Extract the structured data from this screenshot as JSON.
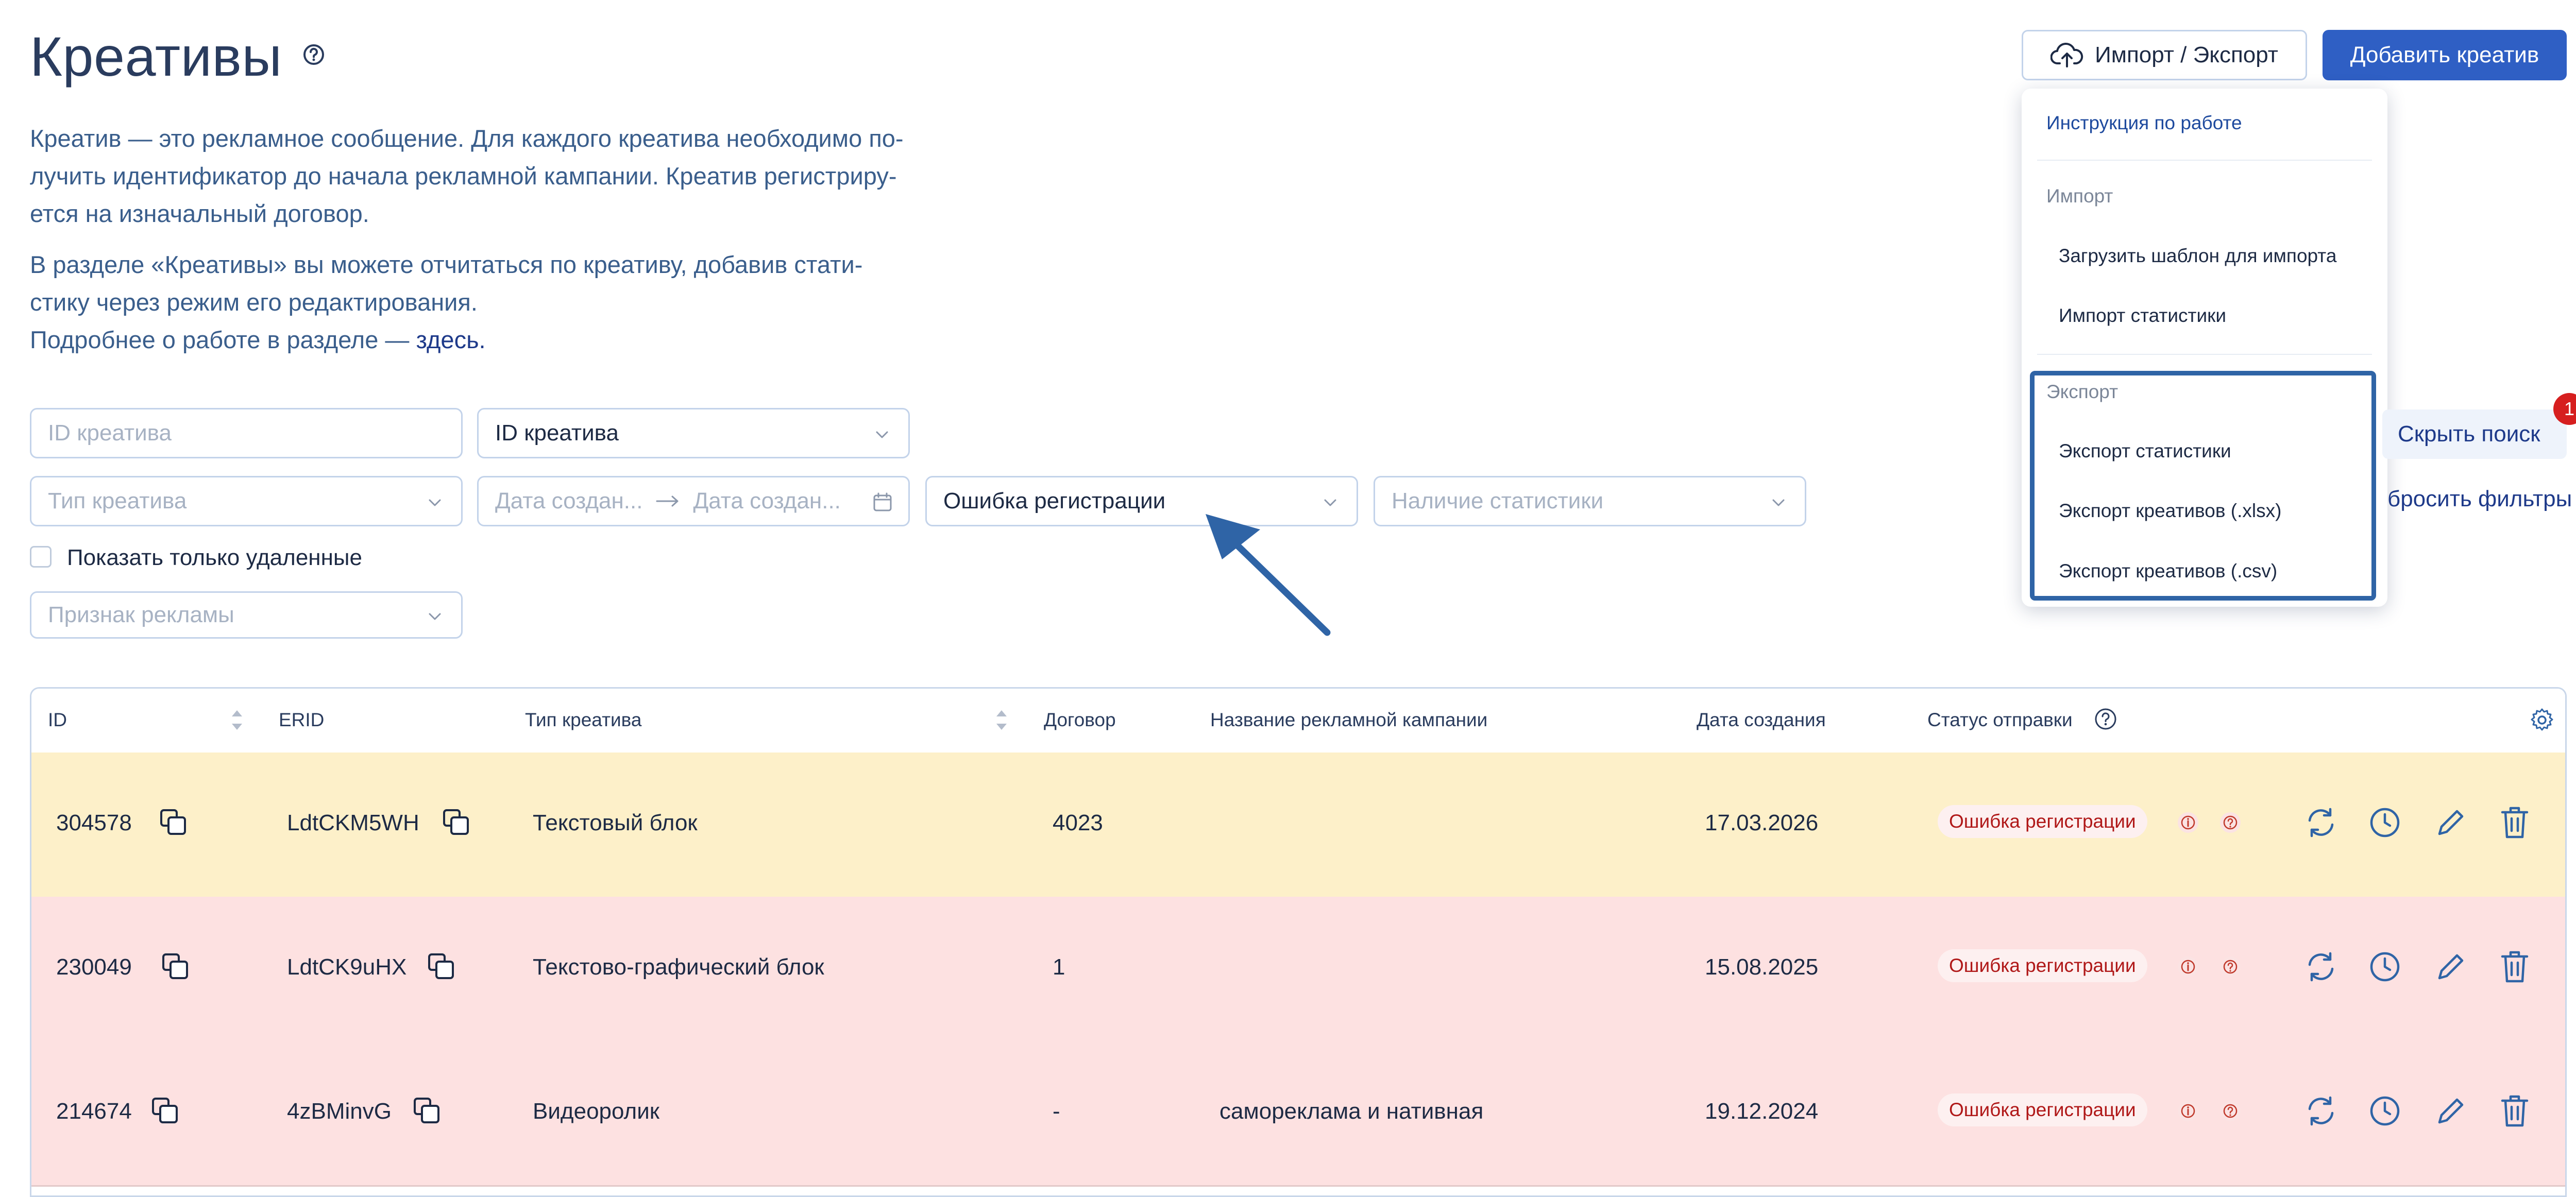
{
  "page": {
    "title": "Креативы",
    "description": {
      "line1": "Креатив — это рекламное сообщение. Для каждого креатива необходимо по-",
      "line2": "лучить идентификатор до начала рекламной кампании. Креатив регистриру-",
      "line3": "ется на изначальный договор.",
      "line4": "В разделе «Креативы» вы можете отчитаться по креативу, добавив стати-",
      "line5": "стику через режим его редактирования.",
      "line6_prefix": "Подробнее о работе в разделе — ",
      "line6_link": "здесь."
    }
  },
  "toolbar": {
    "import_export_label": "Импорт / Экспорт",
    "add_label": "Добавить креатив",
    "primary_color": "#2f5fc4"
  },
  "menu": {
    "instructions": "Инструкция по работе",
    "import_group": "Импорт",
    "download_template": "Загрузить шаблон для импорта",
    "import_stats": "Импорт статистики",
    "export_group": "Экспорт",
    "export_stats": "Экспорт статистики",
    "export_xlsx": "Экспорт креативов (.xlsx)",
    "export_csv": "Экспорт креативов (.csv)"
  },
  "filters": {
    "id_placeholder": "ID креатива",
    "id_select": "ID креатива",
    "type_placeholder": "Тип креатива",
    "date_from_placeholder": "Дата создан...",
    "date_to_placeholder": "Дата создан...",
    "error_select": "Ошибка регистрации",
    "stats_placeholder": "Наличие статистики",
    "show_deleted": "Показать только удаленные",
    "ad_sign_placeholder": "Признак рекламы",
    "hide_search": "Скрыть поиск",
    "hide_search_badge": "1",
    "reset_filters": "бросить фильтры"
  },
  "table": {
    "headers": {
      "id": "ID",
      "erid": "ERID",
      "type": "Тип креатива",
      "contract": "Договор",
      "campaign": "Название рекламной кампании",
      "created": "Дата создания",
      "status": "Статус отправки"
    },
    "rows": [
      {
        "id": "304578",
        "erid": "LdtCKM5WH",
        "type": "Текстовый блок",
        "contract": "4023",
        "campaign": "",
        "created": "17.03.2026",
        "status": "Ошибка регистрации",
        "bg": "#fdf0c9"
      },
      {
        "id": "230049",
        "erid": "LdtCK9uHX",
        "type": "Текстово-графический блок",
        "contract": "1",
        "campaign": "",
        "created": "15.08.2025",
        "status": "Ошибка регистрации",
        "bg": "#fde1e1"
      },
      {
        "id": "214674",
        "erid": "4zBMinvG",
        "type": "Видеоролик",
        "contract": "-",
        "campaign": "самореклама и нативная",
        "created": "19.12.2024",
        "status": "Ошибка регистрации",
        "bg": "#fde1e1"
      }
    ]
  },
  "colors": {
    "row_warning": "#fdf0c9",
    "row_error": "#fde1e1",
    "status_text": "#b01818",
    "annotation": "#2f64a6"
  }
}
